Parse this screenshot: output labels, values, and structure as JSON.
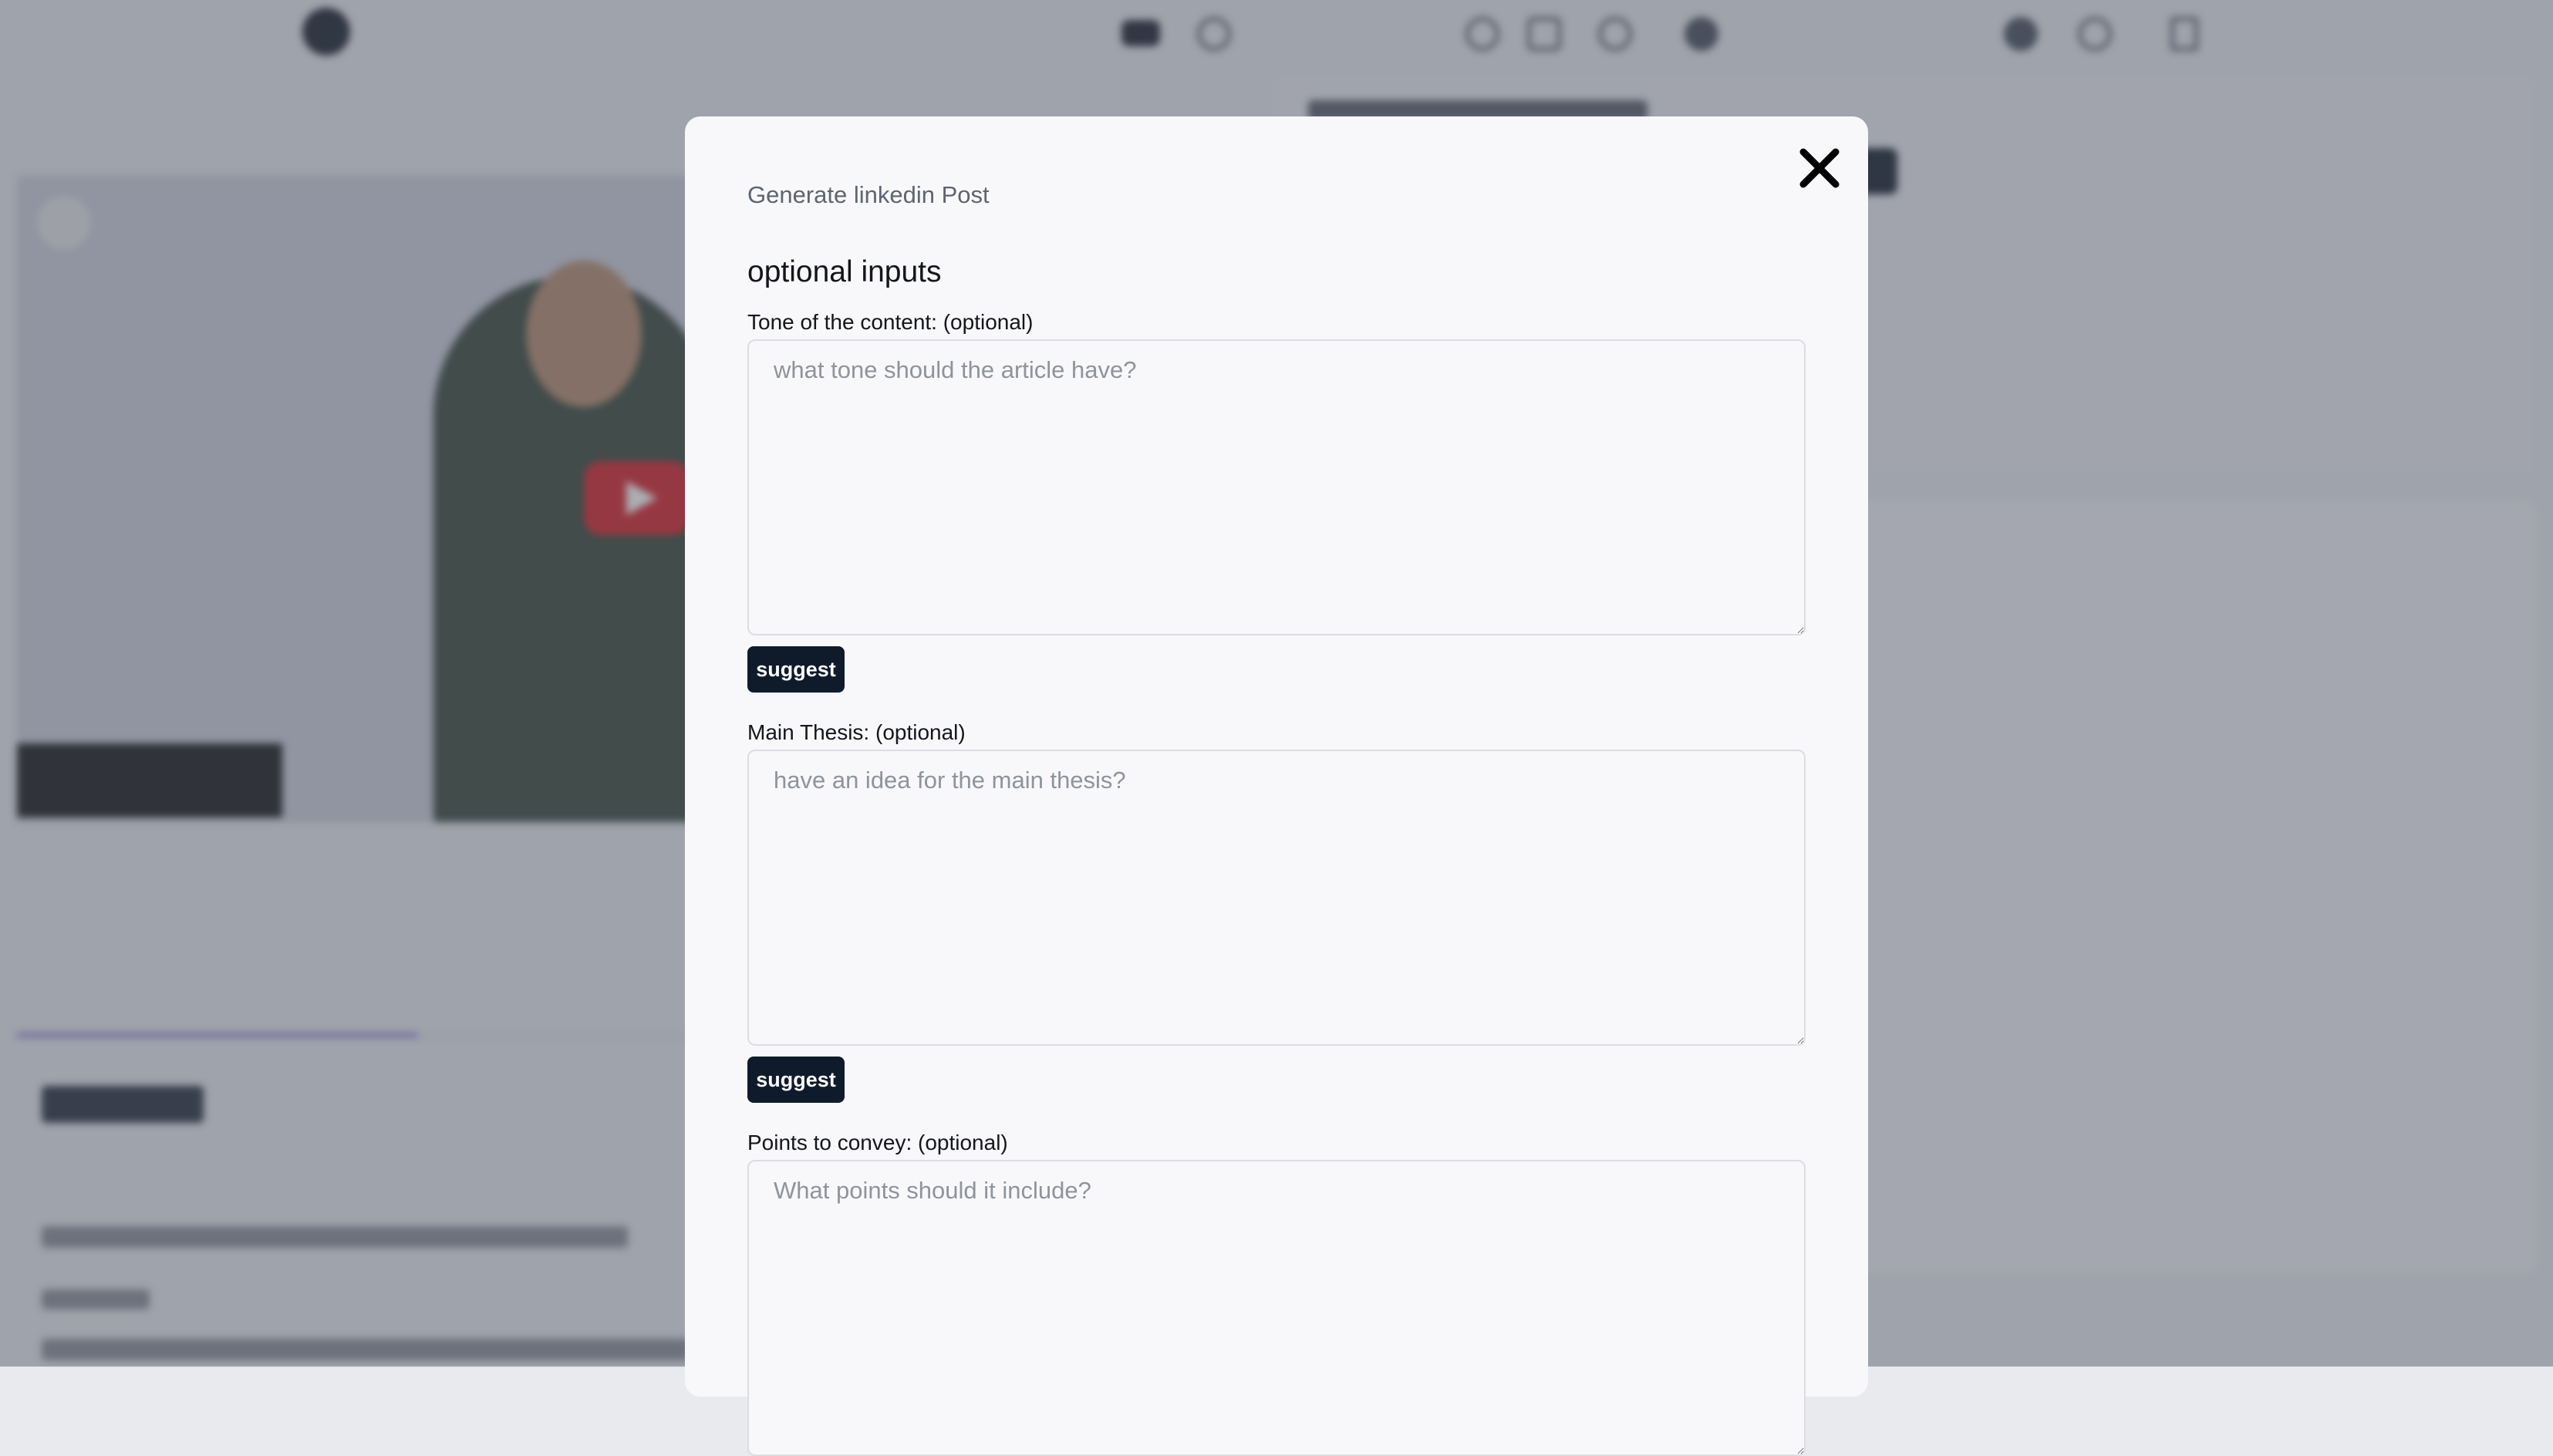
{
  "modal": {
    "title": "Generate linkedin Post",
    "section_title": "optional inputs",
    "fields": [
      {
        "label": "Tone of the content: (optional)",
        "placeholder": "what tone should the article have?",
        "value": "",
        "button_label": "suggest"
      },
      {
        "label": "Main Thesis: (optional)",
        "placeholder": "have an idea for the main thesis?",
        "value": "",
        "button_label": "suggest"
      },
      {
        "label": "Points to convey: (optional)",
        "placeholder": "What points should it include?",
        "value": ""
      }
    ]
  },
  "colors": {
    "accent_button": "#0f1b2a",
    "modal_background": "#f8f8fb",
    "overlay": "#484e5c"
  }
}
